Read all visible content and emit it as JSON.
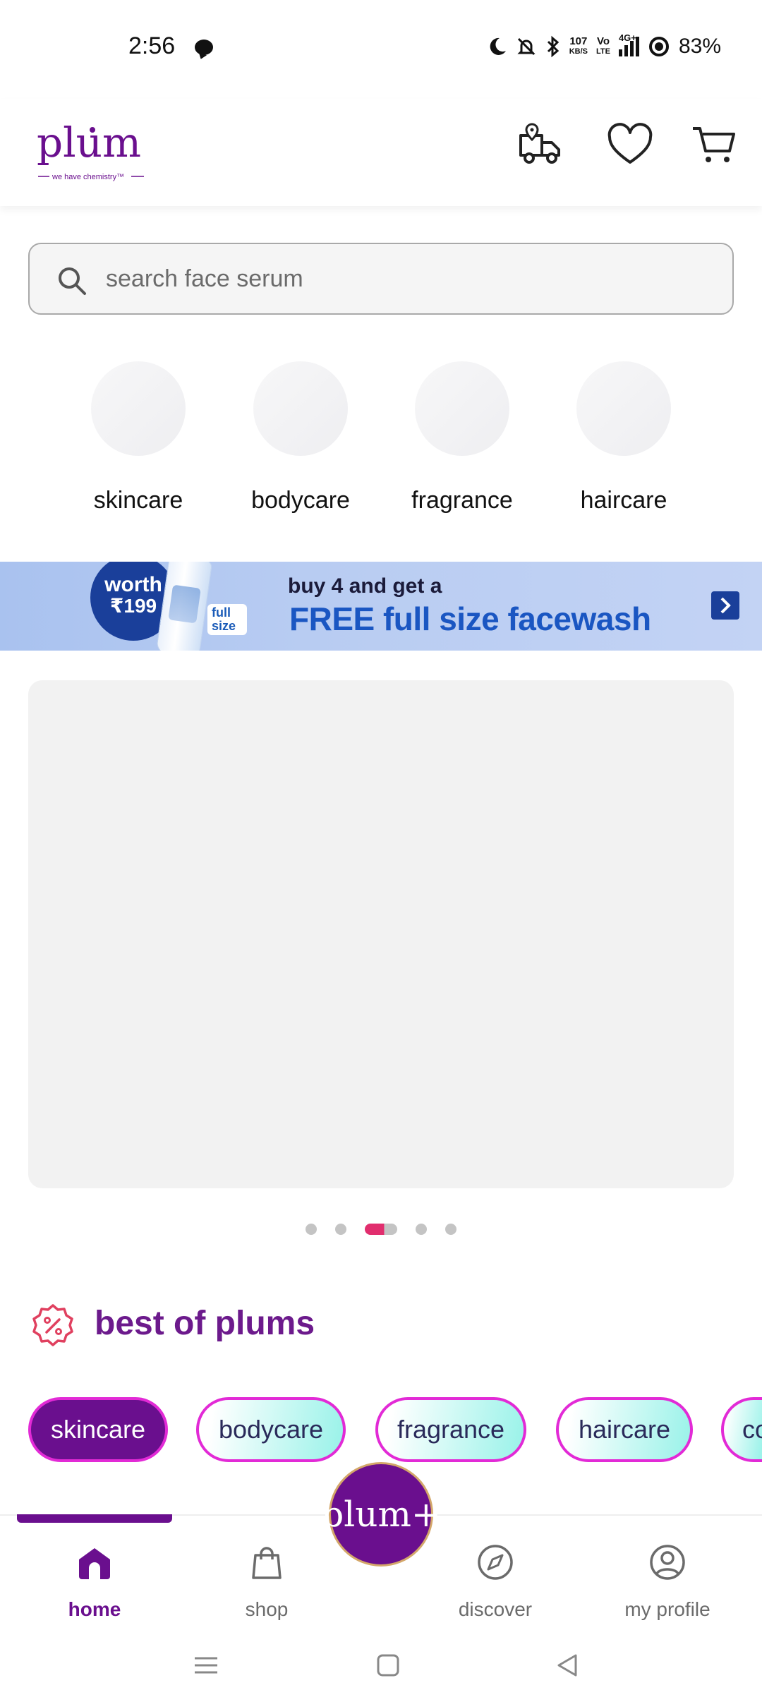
{
  "status_bar": {
    "time": "2:56",
    "net_speed_top": "107",
    "net_speed_unit": "KB/S",
    "volte_top": "Vo",
    "volte_bottom": "LTE",
    "network": "4G+",
    "battery": "83%"
  },
  "header": {
    "logo_text": "plum",
    "logo_tagline": "we have chemistry™"
  },
  "search": {
    "placeholder": "search face serum"
  },
  "categories": [
    {
      "label": "skincare"
    },
    {
      "label": "bodycare"
    },
    {
      "label": "fragrance"
    },
    {
      "label": "haircare"
    }
  ],
  "banner": {
    "badge_line1": "worth",
    "badge_line2": "₹199",
    "tag_line1": "full",
    "tag_line2": "size",
    "line1": "buy 4 and get a",
    "line2": "FREE full size facewash"
  },
  "carousel": {
    "dot_count": 5,
    "active_index": 2
  },
  "best_of_plums": {
    "title": "best of plums",
    "chips": [
      {
        "label": "skincare",
        "active": true
      },
      {
        "label": "bodycare",
        "active": false
      },
      {
        "label": "fragrance",
        "active": false
      },
      {
        "label": "haircare",
        "active": false
      },
      {
        "label": "co",
        "active": false
      }
    ]
  },
  "bottom_nav": {
    "fab_label": "plum+",
    "items": [
      {
        "label": "home",
        "icon": "home-icon",
        "active": true
      },
      {
        "label": "shop",
        "icon": "shopping-bag-icon",
        "active": false
      },
      {
        "label": "discover",
        "icon": "compass-icon",
        "active": false
      },
      {
        "label": "my profile",
        "icon": "profile-icon",
        "active": false
      }
    ]
  },
  "colors": {
    "brand_purple": "#6a0f8e",
    "chip_border": "#e22ad6",
    "chip_gradient_end": "#9ef3ea",
    "banner_blue": "#1a56c2",
    "dot_active": "#e12e6e"
  }
}
